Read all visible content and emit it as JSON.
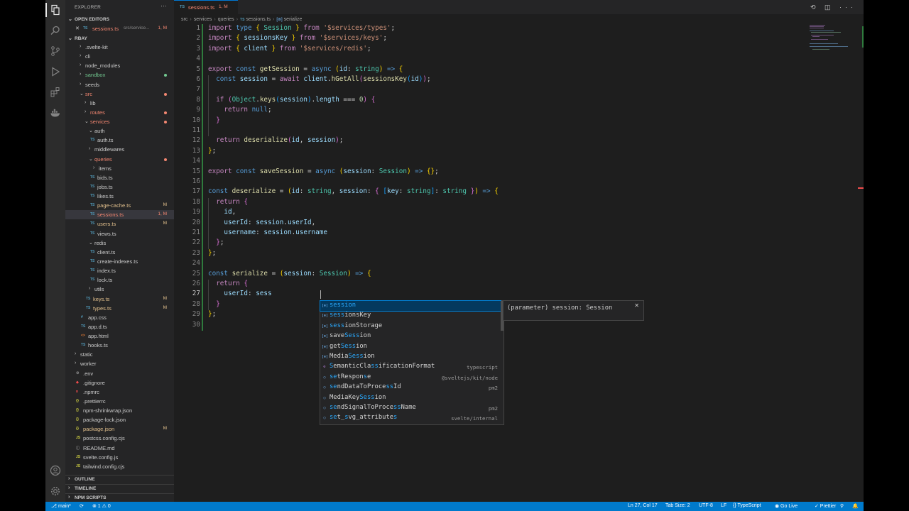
{
  "sidebar": {
    "title": "EXPLORER",
    "more": "···",
    "open_editors_label": "OPEN EDITORS",
    "open_editor": {
      "close": "✕",
      "icon": "TS",
      "name": "sessions.ts",
      "path": "src/service...",
      "status": "1, M"
    },
    "project_label": "RBAY",
    "tree": [
      {
        "label": ".svelte-kit",
        "chevron": "›",
        "icon": ""
      },
      {
        "label": "cli",
        "chevron": "›",
        "icon": ""
      },
      {
        "label": "node_modules",
        "chevron": "›",
        "icon": ""
      },
      {
        "label": "sandbox",
        "chevron": "›",
        "icon": ""
      },
      {
        "label": "seeds",
        "chevron": "›",
        "icon": ""
      },
      {
        "label": "src",
        "chevron": "⌄",
        "icon": ""
      },
      {
        "label": "lib",
        "chevron": "›",
        "icon": ""
      },
      {
        "label": "routes",
        "chevron": "›",
        "icon": ""
      },
      {
        "label": "services",
        "chevron": "⌄",
        "icon": ""
      },
      {
        "label": "auth",
        "chevron": "⌄",
        "icon": ""
      },
      {
        "label": "auth.ts",
        "chevron": "",
        "icon": "TS"
      },
      {
        "label": "middlewares",
        "chevron": "›",
        "icon": ""
      },
      {
        "label": "queries",
        "chevron": "⌄",
        "icon": ""
      },
      {
        "label": "items",
        "chevron": "›",
        "icon": ""
      },
      {
        "label": "bids.ts",
        "chevron": "",
        "icon": "TS"
      },
      {
        "label": "jobs.ts",
        "chevron": "",
        "icon": "TS"
      },
      {
        "label": "likes.ts",
        "chevron": "",
        "icon": "TS"
      },
      {
        "label": "page-cache.ts",
        "chevron": "",
        "icon": "TS",
        "status": "M"
      },
      {
        "label": "sessions.ts",
        "chevron": "",
        "icon": "TS",
        "status": "1, M"
      },
      {
        "label": "users.ts",
        "chevron": "",
        "icon": "TS",
        "status": "M"
      },
      {
        "label": "views.ts",
        "chevron": "",
        "icon": "TS"
      },
      {
        "label": "redis",
        "chevron": "⌄",
        "icon": ""
      },
      {
        "label": "client.ts",
        "chevron": "",
        "icon": "TS"
      },
      {
        "label": "create-indexes.ts",
        "chevron": "",
        "icon": "TS"
      },
      {
        "label": "index.ts",
        "chevron": "",
        "icon": "TS"
      },
      {
        "label": "lock.ts",
        "chevron": "",
        "icon": "TS"
      },
      {
        "label": "utils",
        "chevron": "›",
        "icon": ""
      },
      {
        "label": "keys.ts",
        "chevron": "",
        "icon": "TS",
        "status": "M"
      },
      {
        "label": "types.ts",
        "chevron": "",
        "icon": "TS",
        "status": "M"
      },
      {
        "label": "app.css",
        "chevron": "",
        "icon": "#"
      },
      {
        "label": "app.d.ts",
        "chevron": "",
        "icon": "TS"
      },
      {
        "label": "app.html",
        "chevron": "",
        "icon": "<>"
      },
      {
        "label": "hooks.ts",
        "chevron": "",
        "icon": "TS"
      },
      {
        "label": "static",
        "chevron": "›",
        "icon": ""
      },
      {
        "label": "worker",
        "chevron": "›",
        "icon": ""
      },
      {
        "label": ".env",
        "chevron": "",
        "icon": "⚙"
      },
      {
        "label": ".gitignore",
        "chevron": "",
        "icon": "◆"
      },
      {
        "label": ".npmrc",
        "chevron": "",
        "icon": "n"
      },
      {
        "label": ".prettierrc",
        "chevron": "",
        "icon": "{}"
      },
      {
        "label": "npm-shrinkwrap.json",
        "chevron": "",
        "icon": "{}"
      },
      {
        "label": "package-lock.json",
        "chevron": "",
        "icon": "{}"
      },
      {
        "label": "package.json",
        "chevron": "",
        "icon": "{}",
        "status": "M"
      },
      {
        "label": "postcss.config.cjs",
        "chevron": "",
        "icon": "JS"
      },
      {
        "label": "README.md",
        "chevron": "",
        "icon": "ⓘ"
      },
      {
        "label": "svelte.config.js",
        "chevron": "",
        "icon": "JS"
      },
      {
        "label": "tailwind.config.cjs",
        "chevron": "",
        "icon": "JS"
      }
    ],
    "outline_label": "OUTLINE",
    "timeline_label": "TIMELINE",
    "npm_label": "NPM SCRIPTS"
  },
  "tab": {
    "icon": "TS",
    "name": "sessions.ts",
    "status": "1, M",
    "actions": "⟲ ◫ ···"
  },
  "breadcrumbs": {
    "parts": [
      "src",
      "services",
      "queries"
    ],
    "ts_icon": "TS",
    "file": "sessions.ts",
    "sym_icon": "[⊚]",
    "symbol": "serialize",
    "sep": "›"
  },
  "code": {
    "line_numbers": [
      "1",
      "2",
      "3",
      "4",
      "5",
      "6",
      "7",
      "8",
      "9",
      "10",
      "11",
      "12",
      "13",
      "14",
      "15",
      "16",
      "17",
      "18",
      "19",
      "20",
      "21",
      "22",
      "23",
      "24",
      "25",
      "26",
      "27",
      "28",
      "29",
      "30"
    ],
    "lines": [
      [
        [
          "c",
          "import "
        ],
        [
          "k",
          "type "
        ],
        [
          "b1",
          "{ "
        ],
        [
          "t",
          "Session"
        ],
        [
          "b1",
          " } "
        ],
        [
          "c",
          "from "
        ],
        [
          "s",
          "'$services/types'"
        ],
        [
          "o",
          ";"
        ]
      ],
      [
        [
          "c",
          "import "
        ],
        [
          "b1",
          "{ "
        ],
        [
          "v",
          "sessionsKey"
        ],
        [
          "b1",
          " } "
        ],
        [
          "c",
          "from "
        ],
        [
          "s",
          "'$services/keys'"
        ],
        [
          "o",
          ";"
        ]
      ],
      [
        [
          "c",
          "import "
        ],
        [
          "b1",
          "{ "
        ],
        [
          "v",
          "client"
        ],
        [
          "b1",
          " } "
        ],
        [
          "c",
          "from "
        ],
        [
          "s",
          "'$services/redis'"
        ],
        [
          "o",
          ";"
        ]
      ],
      [],
      [
        [
          "c",
          "export "
        ],
        [
          "k",
          "const "
        ],
        [
          "f",
          "getSession"
        ],
        [
          "o",
          " = "
        ],
        [
          "k",
          "async "
        ],
        [
          "b1",
          "("
        ],
        [
          "v",
          "id"
        ],
        [
          "o",
          ": "
        ],
        [
          "t",
          "string"
        ],
        [
          "b1",
          ")"
        ],
        [
          "k",
          " => "
        ],
        [
          "b1",
          "{"
        ]
      ],
      [
        [
          "o",
          "  "
        ],
        [
          "k",
          "const "
        ],
        [
          "v",
          "session"
        ],
        [
          "o",
          " = "
        ],
        [
          "c",
          "await "
        ],
        [
          "v",
          "client"
        ],
        [
          "o",
          "."
        ],
        [
          "f",
          "hGetAll"
        ],
        [
          "b2",
          "("
        ],
        [
          "f",
          "sessionsKey"
        ],
        [
          "b3",
          "("
        ],
        [
          "v",
          "id"
        ],
        [
          "b3",
          ")"
        ],
        [
          "b2",
          ")"
        ],
        [
          "o",
          ";"
        ]
      ],
      [],
      [
        [
          "o",
          "  "
        ],
        [
          "c",
          "if "
        ],
        [
          "b2",
          "("
        ],
        [
          "t",
          "Object"
        ],
        [
          "o",
          "."
        ],
        [
          "f",
          "keys"
        ],
        [
          "b3",
          "("
        ],
        [
          "v",
          "session"
        ],
        [
          "b3",
          ")"
        ],
        [
          "o",
          "."
        ],
        [
          "v",
          "length"
        ],
        [
          "o",
          " === "
        ],
        [
          "n",
          "0"
        ],
        [
          "b2",
          ")"
        ],
        [
          "o",
          " "
        ],
        [
          "b2",
          "{"
        ]
      ],
      [
        [
          "o",
          "    "
        ],
        [
          "c",
          "return "
        ],
        [
          "k",
          "null"
        ],
        [
          "o",
          ";"
        ]
      ],
      [
        [
          "o",
          "  "
        ],
        [
          "b2",
          "}"
        ]
      ],
      [],
      [
        [
          "o",
          "  "
        ],
        [
          "c",
          "return "
        ],
        [
          "f",
          "deserialize"
        ],
        [
          "b2",
          "("
        ],
        [
          "v",
          "id"
        ],
        [
          "o",
          ", "
        ],
        [
          "v",
          "session"
        ],
        [
          "b2",
          ")"
        ],
        [
          "o",
          ";"
        ]
      ],
      [
        [
          "b1",
          "}"
        ],
        [
          "o",
          ";"
        ]
      ],
      [],
      [
        [
          "c",
          "export "
        ],
        [
          "k",
          "const "
        ],
        [
          "f",
          "saveSession"
        ],
        [
          "o",
          " = "
        ],
        [
          "k",
          "async "
        ],
        [
          "b1",
          "("
        ],
        [
          "v",
          "session"
        ],
        [
          "o",
          ": "
        ],
        [
          "t",
          "Session"
        ],
        [
          "b1",
          ")"
        ],
        [
          "k",
          " => "
        ],
        [
          "b1",
          "{}"
        ],
        [
          "o",
          ";"
        ]
      ],
      [],
      [
        [
          "k",
          "const "
        ],
        [
          "f",
          "deserialize"
        ],
        [
          "o",
          " = "
        ],
        [
          "b1",
          "("
        ],
        [
          "v",
          "id"
        ],
        [
          "o",
          ": "
        ],
        [
          "t",
          "string"
        ],
        [
          "o",
          ", "
        ],
        [
          "v",
          "session"
        ],
        [
          "o",
          ": "
        ],
        [
          "b2",
          "{ "
        ],
        [
          "b3",
          "["
        ],
        [
          "v",
          "key"
        ],
        [
          "o",
          ": "
        ],
        [
          "t",
          "string"
        ],
        [
          "b3",
          "]"
        ],
        [
          "o",
          ": "
        ],
        [
          "t",
          "string"
        ],
        [
          "b2",
          " }"
        ],
        [
          "b1",
          ")"
        ],
        [
          "k",
          " => "
        ],
        [
          "b1",
          "{"
        ]
      ],
      [
        [
          "o",
          "  "
        ],
        [
          "c",
          "return "
        ],
        [
          "b2",
          "{"
        ]
      ],
      [
        [
          "o",
          "    "
        ],
        [
          "v",
          "id"
        ],
        [
          "o",
          ","
        ]
      ],
      [
        [
          "o",
          "    "
        ],
        [
          "v",
          "userId"
        ],
        [
          "o",
          ": "
        ],
        [
          "v",
          "session"
        ],
        [
          "o",
          "."
        ],
        [
          "v",
          "userId"
        ],
        [
          "o",
          ","
        ]
      ],
      [
        [
          "o",
          "    "
        ],
        [
          "v",
          "username"
        ],
        [
          "o",
          ": "
        ],
        [
          "v",
          "session"
        ],
        [
          "o",
          "."
        ],
        [
          "v",
          "username"
        ]
      ],
      [
        [
          "o",
          "  "
        ],
        [
          "b2",
          "}"
        ],
        [
          "o",
          ";"
        ]
      ],
      [
        [
          "b1",
          "}"
        ],
        [
          "o",
          ";"
        ]
      ],
      [],
      [
        [
          "k",
          "const "
        ],
        [
          "f",
          "serialize"
        ],
        [
          "o",
          " = "
        ],
        [
          "b1",
          "("
        ],
        [
          "v",
          "session"
        ],
        [
          "o",
          ": "
        ],
        [
          "t",
          "Session"
        ],
        [
          "b1",
          ")"
        ],
        [
          "k",
          " => "
        ],
        [
          "b1",
          "{"
        ]
      ],
      [
        [
          "o",
          "  "
        ],
        [
          "c",
          "return "
        ],
        [
          "b2",
          "{"
        ]
      ],
      [
        [
          "o",
          "    "
        ],
        [
          "v",
          "userId"
        ],
        [
          "o",
          ": "
        ],
        [
          "v",
          "sess"
        ]
      ],
      [
        [
          "o",
          "  "
        ],
        [
          "b2",
          "}"
        ]
      ],
      [
        [
          "b1",
          "}"
        ],
        [
          "o",
          ";"
        ]
      ],
      []
    ]
  },
  "suggestions": [
    {
      "icon": "[⊚]",
      "pre": "",
      "hl": "session",
      "post": "",
      "detail": ""
    },
    {
      "icon": "[⊚]",
      "pre": "",
      "hl": "sess",
      "post": "ionsKey",
      "detail": ""
    },
    {
      "icon": "[⊚]",
      "pre": "",
      "hl": "sess",
      "post": "ionStorage",
      "detail": ""
    },
    {
      "icon": "[⊚]",
      "pre": "save",
      "hl": "Sess",
      "post": "ion",
      "detail": ""
    },
    {
      "icon": "[⊚]",
      "pre": "get",
      "hl": "Sess",
      "post": "ion",
      "detail": ""
    },
    {
      "icon": "[⊚]",
      "pre": "Media",
      "hl": "Sess",
      "post": "ion",
      "detail": ""
    },
    {
      "icon": "⚙",
      "pre": "",
      "hl": "S",
      "post": "emanticCla|ss|ificationFormat",
      "detail": "typescript"
    },
    {
      "icon": "○",
      "pre": "",
      "hl": "se",
      "post": "tRespon|s|e",
      "detail": "@sveltejs/kit/node"
    },
    {
      "icon": "○",
      "pre": "",
      "hl": "se",
      "post": "ndDataToProce|ss|Id",
      "detail": "pm2"
    },
    {
      "icon": "○",
      "pre": "MediaKey",
      "hl": "Sess",
      "post": "ion",
      "detail": ""
    },
    {
      "icon": "○",
      "pre": "",
      "hl": "se",
      "post": "ndSignalToProce|ss|Name",
      "detail": "pm2"
    },
    {
      "icon": "○",
      "pre": "",
      "hl": "se",
      "post": "t_|s|vg_attribute|s|",
      "detail": "svelte/internal"
    }
  ],
  "details": {
    "text": "(parameter) session: Session",
    "close": "✕"
  },
  "status": {
    "branch": "⎇ main*",
    "sync": "⟳",
    "problems": "⊗ 1 ⚠ 0",
    "position": "Ln 27, Col 17",
    "tabsize": "Tab Size: 2",
    "encoding": "UTF-8",
    "eol": "LF",
    "language": "{} TypeScript",
    "golive": "◉ Go Live",
    "prettier": "✓ Prettier",
    "account": "⚲",
    "bell": "🔔"
  },
  "colors": {
    "accent": "#007acc",
    "modified": "#e2c08d",
    "error": "#f48771",
    "untracked": "#73c991"
  }
}
